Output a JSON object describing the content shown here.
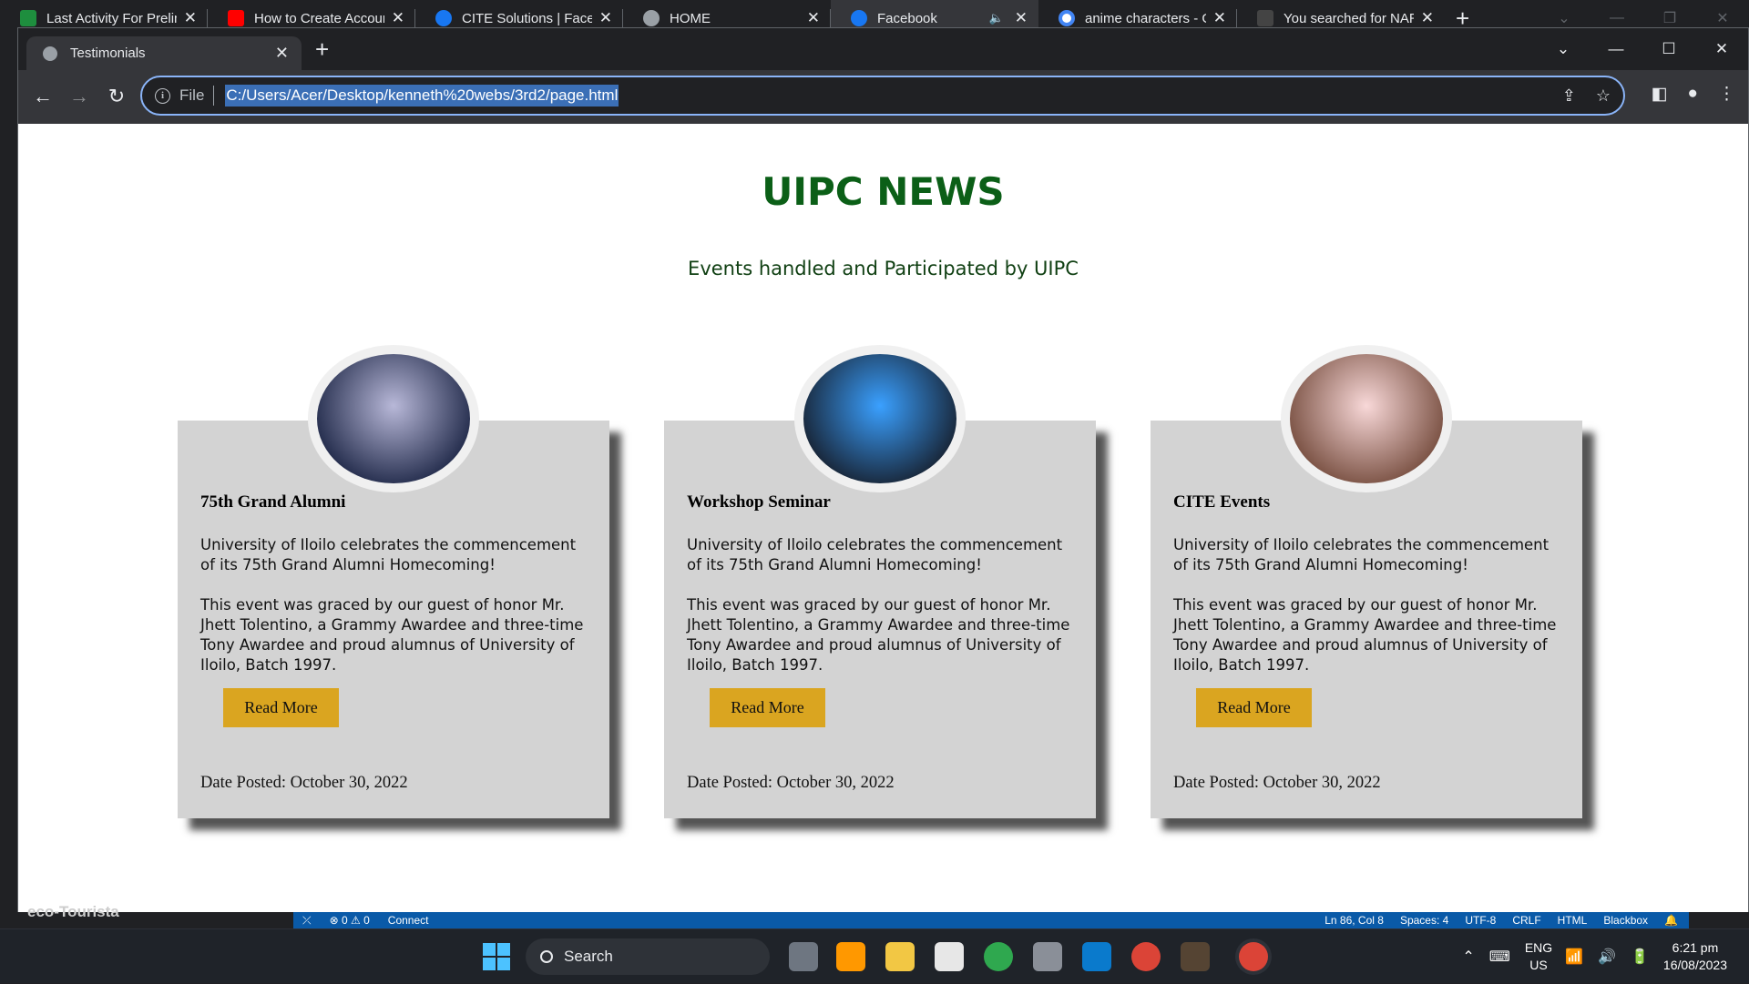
{
  "background_tabs": [
    {
      "title": "Last Activity For Prelim",
      "icon": "classroom-icon",
      "color": "#1e8e3e"
    },
    {
      "title": "How to Create Account",
      "icon": "youtube-icon",
      "color": "#ff0000"
    },
    {
      "title": "CITE Solutions | Faceb",
      "icon": "facebook-icon",
      "color": "#1877f2"
    },
    {
      "title": "HOME",
      "icon": "globe-icon",
      "color": "#9aa0a6"
    },
    {
      "title": "Facebook",
      "icon": "facebook-icon",
      "color": "#1877f2"
    },
    {
      "title": "anime characters - Go",
      "icon": "google-icon",
      "color": "#4285f4"
    },
    {
      "title": "You searched for NAR",
      "icon": "as-icon",
      "color": "#444444"
    }
  ],
  "front_tab": {
    "title": "Testimonials"
  },
  "address": {
    "scheme_label": "File",
    "url": "C:/Users/Acer/Desktop/kenneth%20webs/3rd2/page.html"
  },
  "page": {
    "title": "UIPC NEWS",
    "subtitle": "Events handled and Participated by UIPC",
    "cards": [
      {
        "title": "75th Grand Alumni",
        "para1": "University of Iloilo celebrates the commencement of its 75th Grand Alumni Homecoming!",
        "para2": "This event was graced by our guest of honor Mr. Jhett Tolentino, a Grammy Awardee and three-time Tony Awardee and proud alumnus of University of Iloilo, Batch 1997.",
        "button": "Read More",
        "date": "Date Posted: October 30, 2022",
        "avatar_colors": [
          "#b8b8d8",
          "#101a3a"
        ]
      },
      {
        "title": "Workshop Seminar",
        "para1": "University of Iloilo celebrates the commencement of its 75th Grand Alumni Homecoming!",
        "para2": "This event was graced by our guest of honor Mr. Jhett Tolentino, a Grammy Awardee and three-time Tony Awardee and proud alumnus of University of Iloilo, Batch 1997.",
        "button": "Read More",
        "date": "Date Posted: October 30, 2022",
        "avatar_colors": [
          "#3aa0ff",
          "#14161e"
        ]
      },
      {
        "title": "CITE Events",
        "para1": "University of Iloilo celebrates the commencement of its 75th Grand Alumni Homecoming!",
        "para2": "This event was graced by our guest of honor Mr. Jhett Tolentino, a Grammy Awardee and three-time Tony Awardee and proud alumnus of University of Iloilo, Batch 1997.",
        "button": "Read More",
        "date": "Date Posted: October 30, 2022",
        "avatar_colors": [
          "#f8d8d8",
          "#6a4030"
        ]
      }
    ]
  },
  "vscode_status": {
    "behind_text": "eco-Tourista",
    "problems": "⊗ 0 ⚠ 0",
    "connect": "Connect",
    "ln_col": "Ln 86, Col 8",
    "spaces": "Spaces: 4",
    "encoding": "UTF-8",
    "eol": "CRLF",
    "language": "HTML",
    "extension": "Blackbox"
  },
  "taskbar": {
    "search": "Search",
    "lang_top": "ENG",
    "lang_bottom": "US",
    "time": "6:21 pm",
    "date": "16/08/2023"
  }
}
